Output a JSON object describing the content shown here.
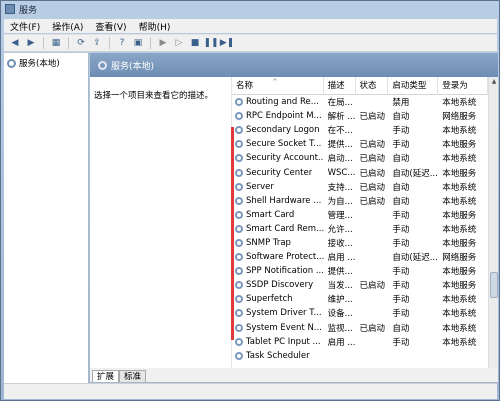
{
  "window": {
    "title": "服务"
  },
  "menu": [
    {
      "label": "文件(F)"
    },
    {
      "label": "操作(A)"
    },
    {
      "label": "查看(V)"
    },
    {
      "label": "帮助(H)"
    }
  ],
  "toolbar_icons": [
    "back-icon",
    "forward-icon",
    "console-tree-icon",
    "refresh-icon",
    "export-icon",
    "help-icon",
    "properties-icon",
    "play-icon",
    "play-alt-icon",
    "stop-icon",
    "pause-icon",
    "restart-icon"
  ],
  "tree": {
    "root_label": "服务(本地)"
  },
  "content": {
    "header_title": "服务(本地)",
    "description_hint": "选择一个项目来查看它的描述。"
  },
  "columns": {
    "name": "名称",
    "description": "描述",
    "status": "状态",
    "startup": "启动类型",
    "logon": "登录为"
  },
  "services": [
    {
      "name": "Routing and Re...",
      "desc": "在局...",
      "status": "",
      "startup": "禁用",
      "logon": "本地系统"
    },
    {
      "name": "RPC Endpoint M...",
      "desc": "解析 ...",
      "status": "已启动",
      "startup": "自动",
      "logon": "网络服务"
    },
    {
      "name": "Secondary Logon",
      "desc": "在不...",
      "status": "",
      "startup": "手动",
      "logon": "本地系统"
    },
    {
      "name": "Secure Socket T...",
      "desc": "提供...",
      "status": "已启动",
      "startup": "手动",
      "logon": "本地服务"
    },
    {
      "name": "Security Account...",
      "desc": "启动...",
      "status": "已启动",
      "startup": "自动",
      "logon": "本地系统"
    },
    {
      "name": "Security Center",
      "desc": "WSC...",
      "status": "已启动",
      "startup": "自动(延迟...",
      "logon": "本地服务"
    },
    {
      "name": "Server",
      "desc": "支持...",
      "status": "已启动",
      "startup": "自动",
      "logon": "本地系统"
    },
    {
      "name": "Shell Hardware ...",
      "desc": "为自...",
      "status": "已启动",
      "startup": "自动",
      "logon": "本地系统"
    },
    {
      "name": "Smart Card",
      "desc": "管理...",
      "status": "",
      "startup": "手动",
      "logon": "本地服务"
    },
    {
      "name": "Smart Card Rem...",
      "desc": "允许...",
      "status": "",
      "startup": "手动",
      "logon": "本地系统"
    },
    {
      "name": "SNMP Trap",
      "desc": "接收...",
      "status": "",
      "startup": "手动",
      "logon": "本地服务"
    },
    {
      "name": "Software Protect...",
      "desc": "启用 ...",
      "status": "",
      "startup": "自动(延迟...",
      "logon": "网络服务"
    },
    {
      "name": "SPP Notification ...",
      "desc": "提供...",
      "status": "",
      "startup": "手动",
      "logon": "本地服务"
    },
    {
      "name": "SSDP Discovery",
      "desc": "当发...",
      "status": "已启动",
      "startup": "手动",
      "logon": "本地服务"
    },
    {
      "name": "Superfetch",
      "desc": "维护...",
      "status": "",
      "startup": "手动",
      "logon": "本地系统"
    },
    {
      "name": "System Driver T...",
      "desc": "设备...",
      "status": "",
      "startup": "手动",
      "logon": "本地系统"
    },
    {
      "name": "System Event N...",
      "desc": "监视...",
      "status": "已启动",
      "startup": "自动",
      "logon": "本地系统"
    },
    {
      "name": "Tablet PC Input ...",
      "desc": "启用 ...",
      "status": "",
      "startup": "手动",
      "logon": "本地系统"
    },
    {
      "name": "Task Scheduler",
      "desc": "",
      "status": "",
      "startup": "",
      "logon": ""
    }
  ],
  "tabs": [
    {
      "label": "扩展"
    },
    {
      "label": "标准"
    }
  ],
  "colors": {
    "header_blue": "#7c9bc0",
    "highlight_red": "#e03a3a"
  }
}
